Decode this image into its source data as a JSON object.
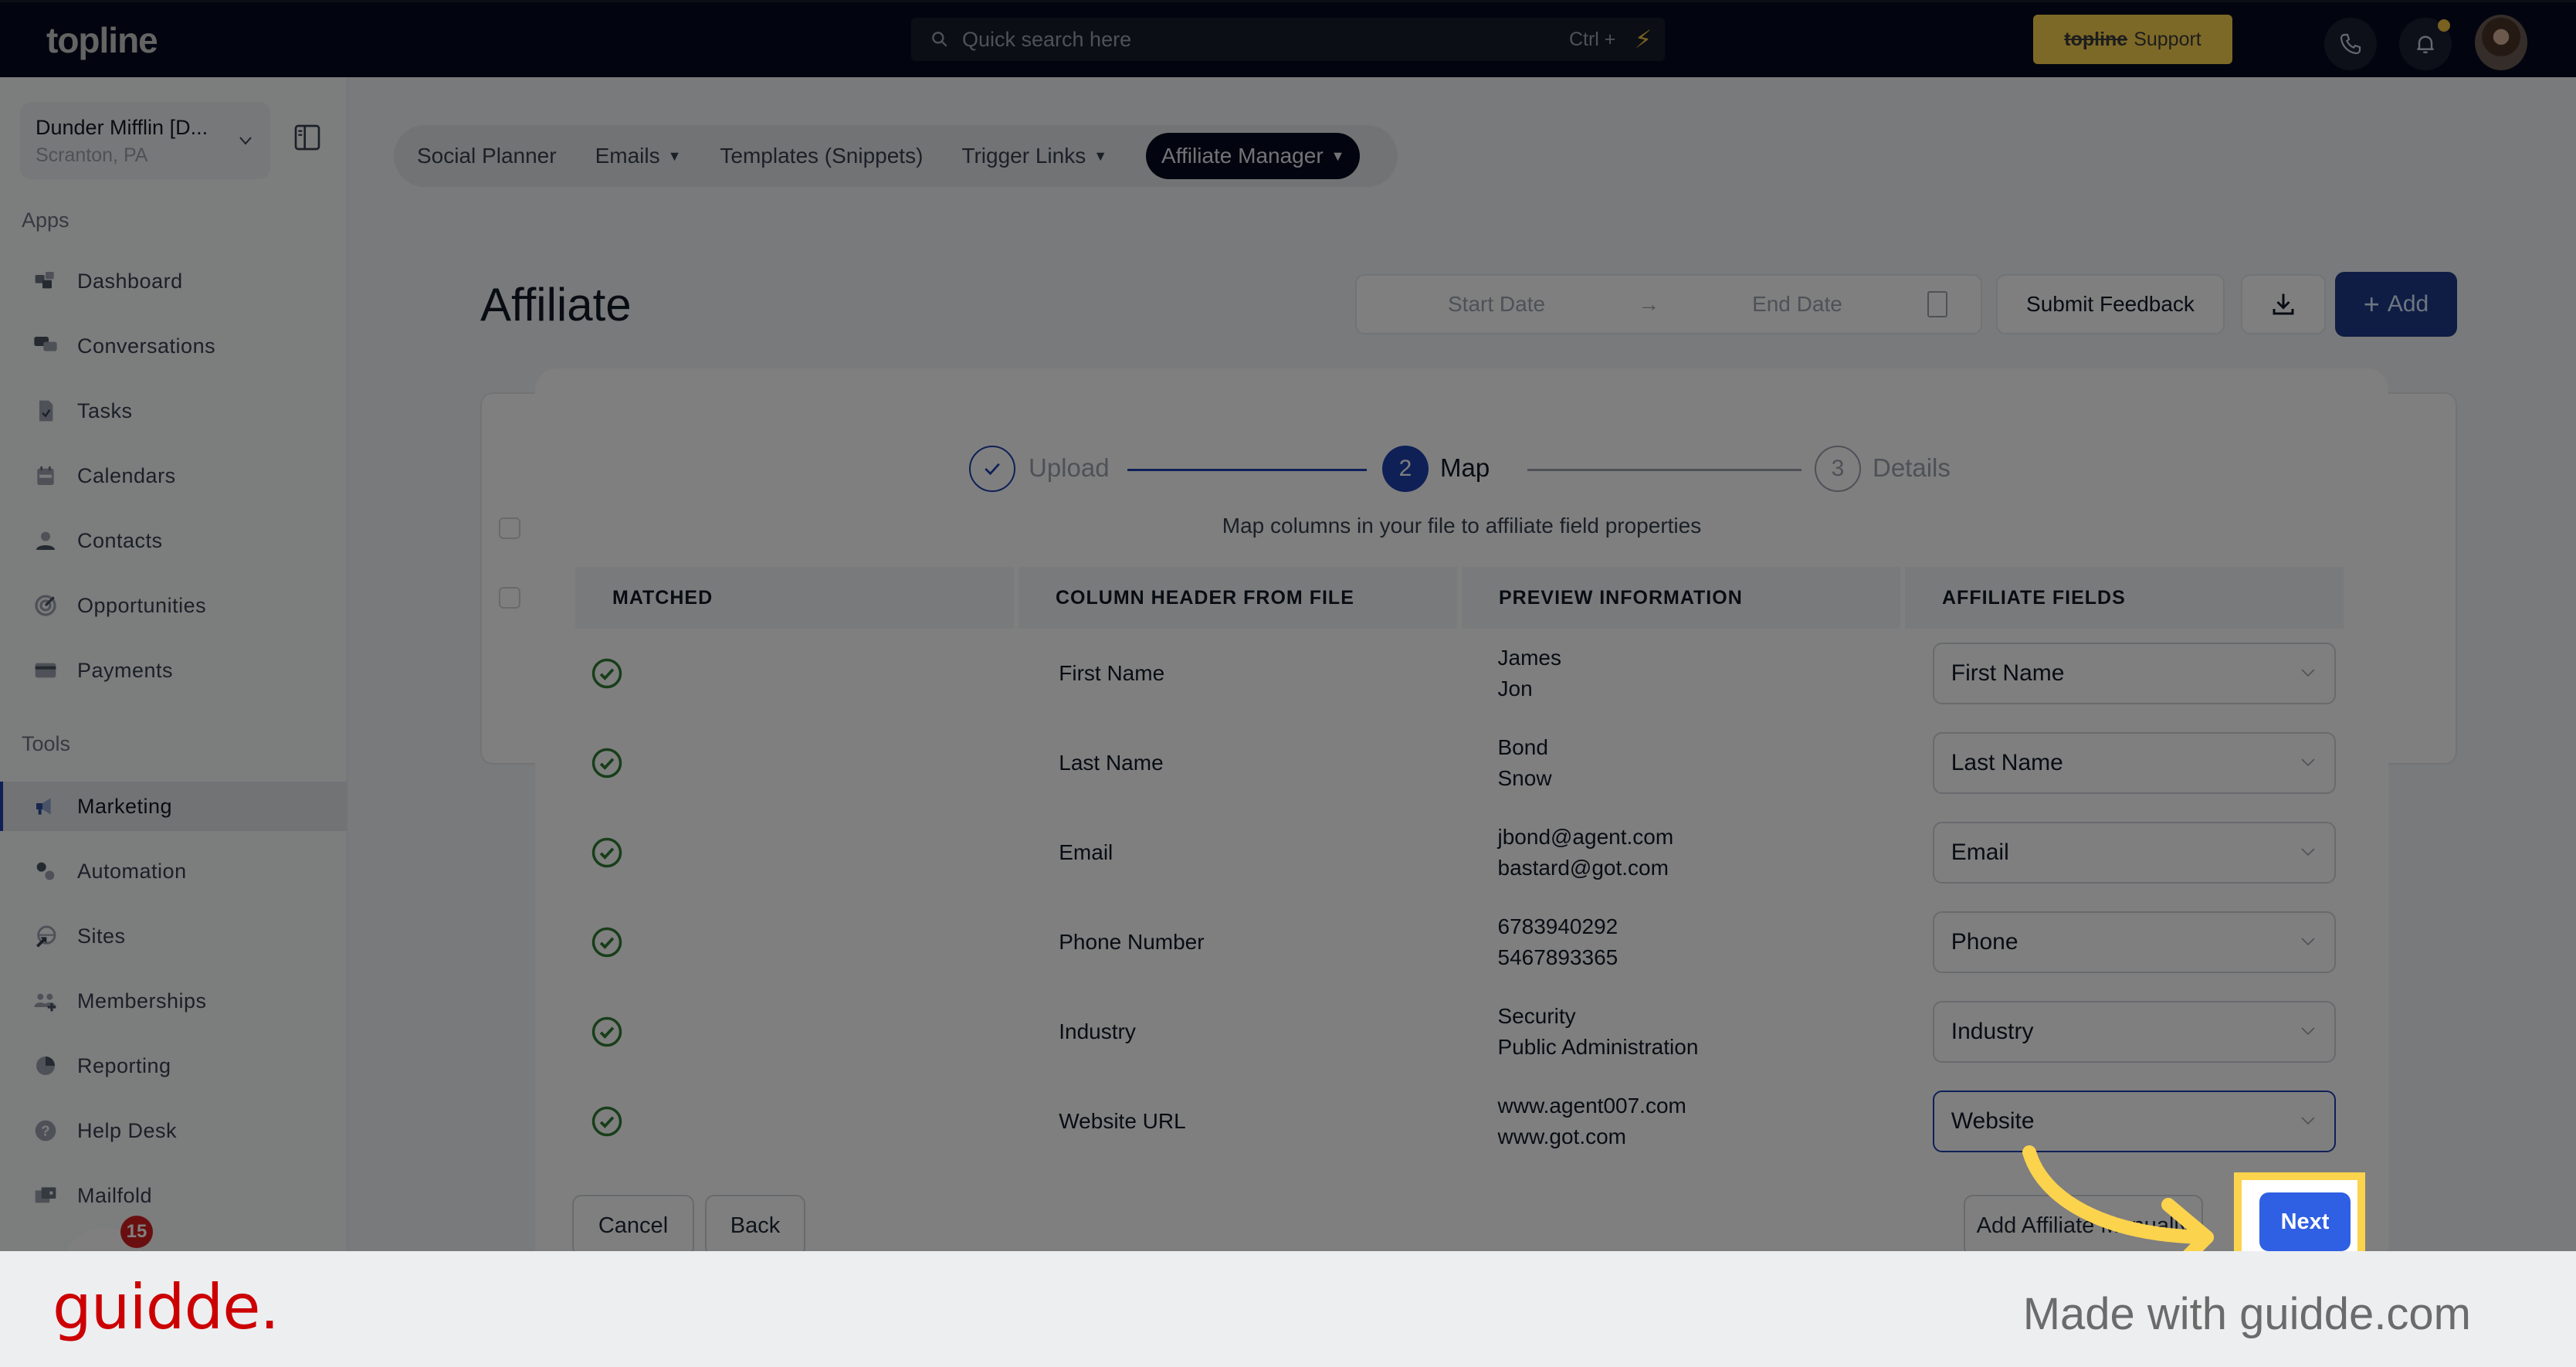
{
  "header": {
    "logo": "topline",
    "search_placeholder": "Quick search here",
    "search_shortcut": "Ctrl + K",
    "support_brand": "topline",
    "support_label": "Support",
    "accent_color": "#fbd24e"
  },
  "sidebar": {
    "workspace_name": "Dunder Mifflin [D...",
    "workspace_location": "Scranton, PA",
    "apps_label": "Apps",
    "apps": [
      {
        "label": "Dashboard",
        "icon": "dashboard-icon"
      },
      {
        "label": "Conversations",
        "icon": "chat-bubbles-icon"
      },
      {
        "label": "Tasks",
        "icon": "task-file-icon"
      },
      {
        "label": "Calendars",
        "icon": "calendar-icon"
      },
      {
        "label": "Contacts",
        "icon": "person-icon"
      },
      {
        "label": "Opportunities",
        "icon": "target-icon"
      },
      {
        "label": "Payments",
        "icon": "credit-card-icon"
      }
    ],
    "tools_label": "Tools",
    "tools": [
      {
        "label": "Marketing",
        "icon": "megaphone-icon",
        "active": true
      },
      {
        "label": "Automation",
        "icon": "gears-icon"
      },
      {
        "label": "Sites",
        "icon": "globe-cursor-icon"
      },
      {
        "label": "Memberships",
        "icon": "users-plus-icon"
      },
      {
        "label": "Reporting",
        "icon": "pie-chart-icon"
      },
      {
        "label": "Help Desk",
        "icon": "question-icon"
      },
      {
        "label": "Mailfold",
        "icon": "mail-box-icon"
      }
    ],
    "chat_badge_count": "15"
  },
  "tabs": [
    {
      "label": "Social Planner",
      "dropdown": false
    },
    {
      "label": "Emails",
      "dropdown": true
    },
    {
      "label": "Templates (Snippets)",
      "dropdown": false
    },
    {
      "label": "Trigger Links",
      "dropdown": true
    },
    {
      "label": "Affiliate Manager",
      "dropdown": true,
      "active": true
    }
  ],
  "page": {
    "title": "Affiliate",
    "start_date_placeholder": "Start Date",
    "end_date_placeholder": "End Date",
    "submit_feedback_label": "Submit Feedback",
    "add_label": "Add"
  },
  "modal": {
    "steps": [
      {
        "number": "1",
        "label": "Upload",
        "state": "complete"
      },
      {
        "number": "2",
        "label": "Map",
        "state": "current"
      },
      {
        "number": "3",
        "label": "Details",
        "state": "upcoming"
      }
    ],
    "subtitle": "Map columns in your file to affiliate field properties",
    "columns": [
      "MATCHED",
      "COLUMN HEADER FROM FILE",
      "PREVIEW INFORMATION",
      "AFFILIATE FIELDS"
    ],
    "rows": [
      {
        "matched": true,
        "column": "First Name",
        "preview": [
          "James",
          "Jon"
        ],
        "field": "First Name"
      },
      {
        "matched": true,
        "column": "Last Name",
        "preview": [
          "Bond",
          "Snow"
        ],
        "field": "Last Name"
      },
      {
        "matched": true,
        "column": "Email",
        "preview": [
          "jbond@agent.com",
          "bastard@got.com"
        ],
        "field": "Email"
      },
      {
        "matched": true,
        "column": "Phone Number",
        "preview": [
          "6783940292",
          "5467893365"
        ],
        "field": "Phone"
      },
      {
        "matched": true,
        "column": "Industry",
        "preview": [
          "Security",
          "Public Administration"
        ],
        "field": "Industry"
      },
      {
        "matched": true,
        "column": "Website URL",
        "preview": [
          "www.agent007.com",
          "www.got.com"
        ],
        "field": "Website",
        "focused": true
      }
    ],
    "cancel_label": "Cancel",
    "back_label": "Back",
    "add_manually_label": "Add Affiliate Manually",
    "next_label": "Next",
    "primary_color": "#2f5fe3",
    "matched_color": "#2e7d32"
  },
  "footer": {
    "brand": "guidde.",
    "made_with": "Made with guidde.com"
  }
}
